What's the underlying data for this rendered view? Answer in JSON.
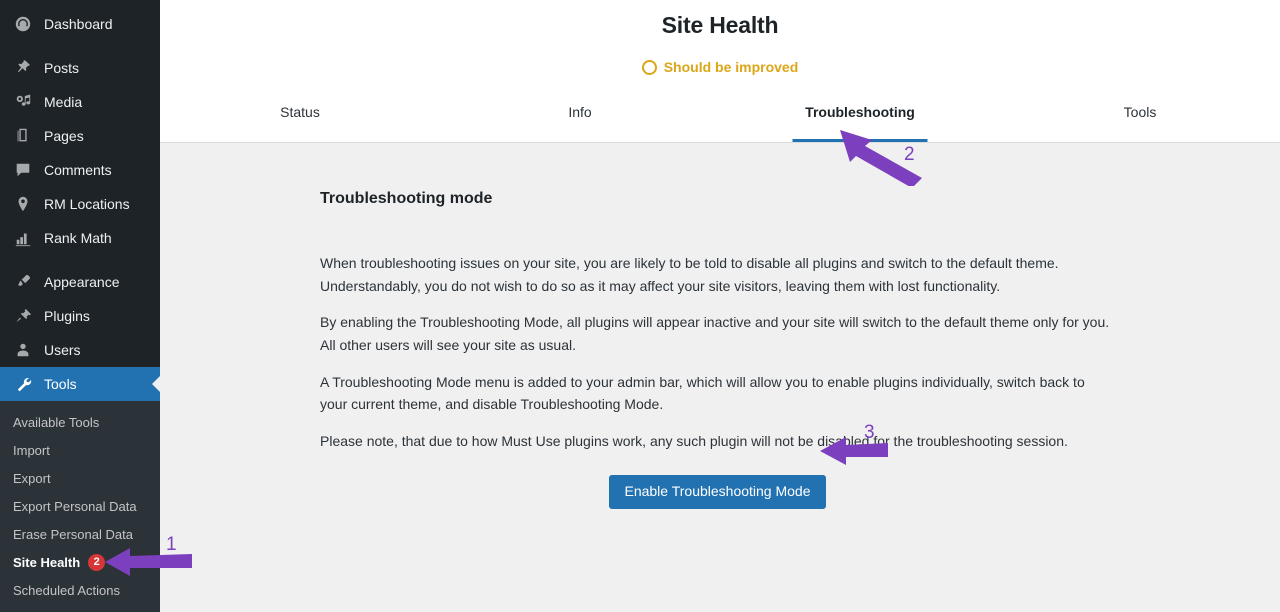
{
  "sidebar": {
    "items": [
      {
        "label": "Dashboard",
        "icon": "dashboard-icon",
        "active": false
      },
      {
        "label": "Posts",
        "icon": "pin-icon",
        "active": false
      },
      {
        "label": "Media",
        "icon": "media-icon",
        "active": false
      },
      {
        "label": "Pages",
        "icon": "pages-icon",
        "active": false
      },
      {
        "label": "Comments",
        "icon": "comments-icon",
        "active": false
      },
      {
        "label": "RM Locations",
        "icon": "location-pin-icon",
        "active": false
      },
      {
        "label": "Rank Math",
        "icon": "bar-chart-icon",
        "active": false
      },
      {
        "label": "Appearance",
        "icon": "paintbrush-icon",
        "active": false
      },
      {
        "label": "Plugins",
        "icon": "plug-icon",
        "active": false
      },
      {
        "label": "Users",
        "icon": "user-icon",
        "active": false
      },
      {
        "label": "Tools",
        "icon": "wrench-icon",
        "active": true
      }
    ],
    "submenu": [
      {
        "label": "Available Tools",
        "current": false,
        "badge": ""
      },
      {
        "label": "Import",
        "current": false,
        "badge": ""
      },
      {
        "label": "Export",
        "current": false,
        "badge": ""
      },
      {
        "label": "Export Personal Data",
        "current": false,
        "badge": ""
      },
      {
        "label": "Erase Personal Data",
        "current": false,
        "badge": ""
      },
      {
        "label": "Site Health",
        "current": true,
        "badge": "2"
      },
      {
        "label": "Scheduled Actions",
        "current": false,
        "badge": ""
      }
    ]
  },
  "header": {
    "title": "Site Health",
    "status_text": "Should be improved",
    "status_color": "#dba617",
    "status_icon": "circle-outline-icon",
    "tabs": [
      {
        "label": "Status",
        "active": false
      },
      {
        "label": "Info",
        "active": false
      },
      {
        "label": "Troubleshooting",
        "active": true
      },
      {
        "label": "Tools",
        "active": false
      }
    ],
    "accent_color": "#2271b1"
  },
  "content": {
    "section_title": "Troubleshooting mode",
    "paragraphs": [
      "When troubleshooting issues on your site, you are likely to be told to disable all plugins and switch to the default theme. Understandably, you do not wish to do so as it may affect your site visitors, leaving them with lost functionality.",
      "By enabling the Troubleshooting Mode, all plugins will appear inactive and your site will switch to the default theme only for you. All other users will see your site as usual.",
      "A Troubleshooting Mode menu is added to your admin bar, which will allow you to enable plugins individually, switch back to your current theme, and disable Troubleshooting Mode.",
      "Please note, that due to how Must Use plugins work, any such plugin will not be disabled for the troubleshooting session."
    ],
    "button_label": "Enable Troubleshooting Mode"
  },
  "annotations": {
    "color": "#7c3fbe",
    "markers": [
      {
        "number": "1",
        "target": "sidebar-item-site-health"
      },
      {
        "number": "2",
        "target": "tab-troubleshooting"
      },
      {
        "number": "3",
        "target": "enable-troubleshooting-mode-button"
      }
    ]
  }
}
